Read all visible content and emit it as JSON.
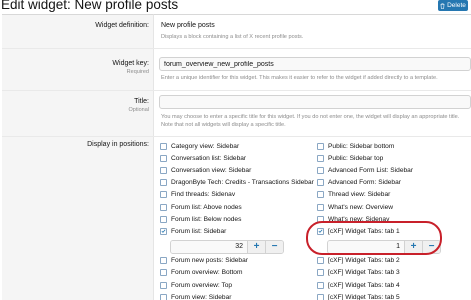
{
  "header": {
    "title": "Edit widget: New profile posts",
    "delete_label": "Delete"
  },
  "definition": {
    "label": "Widget definition:",
    "value": "New profile posts",
    "description": "Displays a block containing a list of X recent profile posts."
  },
  "widget_key": {
    "label": "Widget key:",
    "sublabel": "Required",
    "value": "forum_overview_new_profile_posts",
    "hint": "Enter a unique identifier for this widget. This makes it easier to refer to the widget if added directly to a template."
  },
  "title": {
    "label": "Title:",
    "sublabel": "Optional",
    "value": "",
    "hint_line1": "You may choose to enter a specific title for this widget. If you do not enter one, the widget will display an appropriate title.",
    "hint_line2": "Note that not all widgets will display a specific title."
  },
  "positions": {
    "label": "Display in positions:",
    "left": [
      {
        "label": "Category view: Sidebar",
        "checked": false
      },
      {
        "label": "Conversation list: Sidebar",
        "checked": false
      },
      {
        "label": "Conversation view: Sidebar",
        "checked": false
      },
      {
        "label": "DragonByte Tech: Credits - Transactions Sidebar",
        "checked": false
      },
      {
        "label": "Find threads: Sidenav",
        "checked": false
      },
      {
        "label": "Forum list: Above nodes",
        "checked": false
      },
      {
        "label": "Forum list: Below nodes",
        "checked": false
      },
      {
        "label": "Forum list: Sidebar",
        "checked": true,
        "order": "32"
      },
      {
        "label": "Forum new posts: Sidebar",
        "checked": false
      },
      {
        "label": "Forum overview: Bottom",
        "checked": false
      },
      {
        "label": "Forum overview: Top",
        "checked": false
      },
      {
        "label": "Forum view: Sidebar",
        "checked": false
      }
    ],
    "right": [
      {
        "label": "Public: Sidebar bottom",
        "checked": false
      },
      {
        "label": "Public: Sidebar top",
        "checked": false
      },
      {
        "label": "Advanced Form List: Sidebar",
        "checked": false
      },
      {
        "label": "Advanced Form: Sidebar",
        "checked": false
      },
      {
        "label": "Thread view: Sidebar",
        "checked": false
      },
      {
        "label": "What's new: Overview",
        "checked": false
      },
      {
        "label": "What's new: Sidenav",
        "checked": false
      },
      {
        "label": "[cXF] Widget Tabs: tab 1",
        "checked": true,
        "order": "1"
      },
      {
        "label": "[cXF] Widget Tabs: tab 2",
        "checked": false
      },
      {
        "label": "[cXF] Widget Tabs: tab 3",
        "checked": false
      },
      {
        "label": "[cXF] Widget Tabs: tab 4",
        "checked": false
      },
      {
        "label": "[cXF] Widget Tabs: tab 5",
        "checked": false
      }
    ],
    "plus": "+",
    "minus": "−"
  },
  "colors": {
    "accent": "#2577b1",
    "highlight": "#c8202a"
  }
}
